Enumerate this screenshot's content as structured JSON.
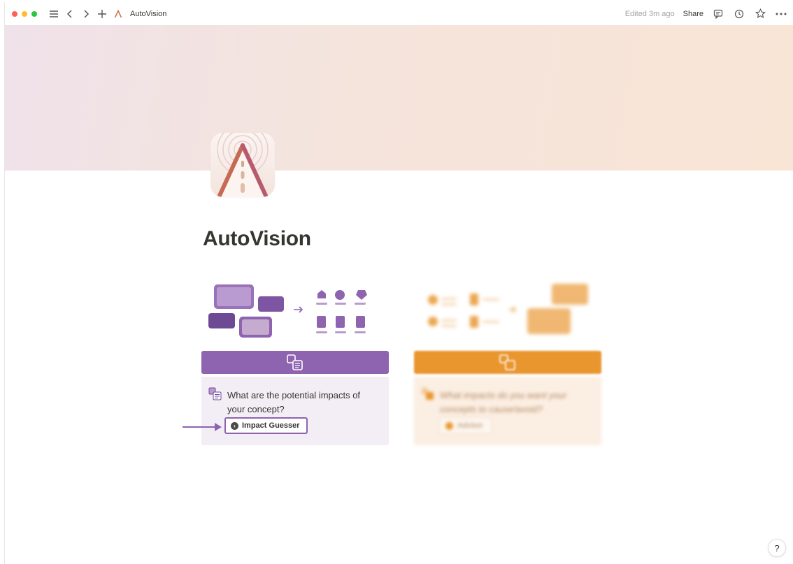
{
  "titlebar": {
    "page_title": "AutoVision",
    "edited": "Edited 3m ago",
    "share_label": "Share"
  },
  "page": {
    "title": "AutoVision"
  },
  "cards": [
    {
      "accent": "#8e63b0",
      "question": "What are the potential impacts of your concept?",
      "button_label": "Impact Guesser",
      "button_icon": "arrow-right-circle-icon"
    },
    {
      "accent": "#e9962f",
      "question": "What impacts do you want your concepts to cause/avoid?",
      "button_label": "Advisor",
      "button_icon": "orange-circle-icon"
    }
  ],
  "help": {
    "label": "?"
  },
  "colors": {
    "cover_start": "#efe2e9",
    "cover_end": "#f9e5d6",
    "purple": "#8e63b0",
    "orange": "#e9962f"
  }
}
